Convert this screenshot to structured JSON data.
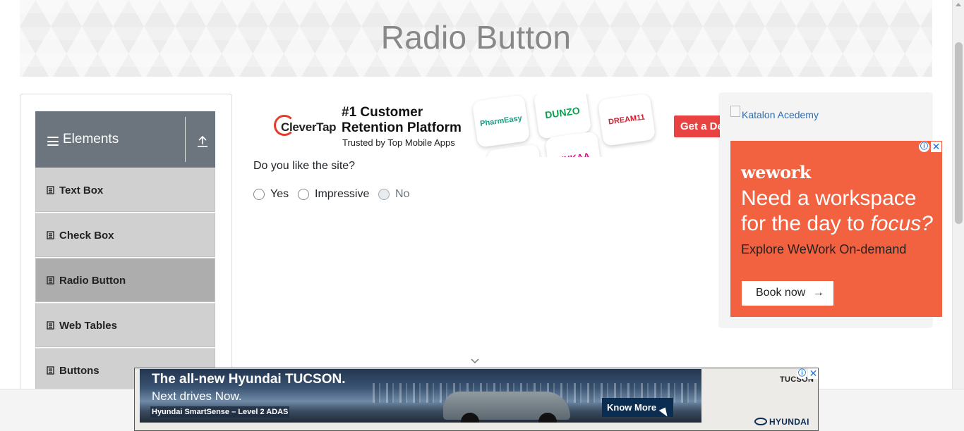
{
  "page": {
    "title": "Radio Button"
  },
  "sidebar": {
    "group_title": "Elements",
    "items": [
      {
        "label": "Text Box",
        "active": false
      },
      {
        "label": "Check Box",
        "active": false
      },
      {
        "label": "Radio Button",
        "active": true
      },
      {
        "label": "Web Tables",
        "active": false
      },
      {
        "label": "Buttons",
        "active": false
      }
    ]
  },
  "main": {
    "question": "Do you like the site?",
    "options": [
      {
        "label": "Yes",
        "disabled": false
      },
      {
        "label": "Impressive",
        "disabled": false
      },
      {
        "label": "No",
        "disabled": true
      }
    ]
  },
  "ads": {
    "clevertap": {
      "brand": "CleverTap",
      "headline_1": "#1 Customer",
      "headline_2": "Retention Platform",
      "subtitle": "Trusted by Top Mobile Apps",
      "apps": [
        "PharmEasy",
        "DUNZO",
        "DREAM11",
        "NYKAA"
      ],
      "cta": "Get a Demo"
    },
    "broken_image_alt": "Katalon Acedemy",
    "wework": {
      "brand": "wework",
      "headline_1": "Need a workspace",
      "headline_2": "for the day to ",
      "headline_emph": "focus?",
      "subtitle": "Explore WeWork On-demand",
      "cta": "Book now",
      "cta_arrow": "→",
      "accent_color": "#f26241"
    },
    "hyundai": {
      "headline": "The all-new Hyundai TUCSON.",
      "subline": "Next drives Now.",
      "tag": "Hyundai SmartSense – Level 2 ADAS",
      "cta": "Know More",
      "model": "TUCSON",
      "logo": "HYUNDAI"
    },
    "info_glyph": "ⓘ",
    "close_glyph": "✕"
  },
  "colors": {
    "sidebar_header": "#6c757d",
    "menu_item": "#d0d0d0",
    "menu_item_active": "#adadad"
  }
}
